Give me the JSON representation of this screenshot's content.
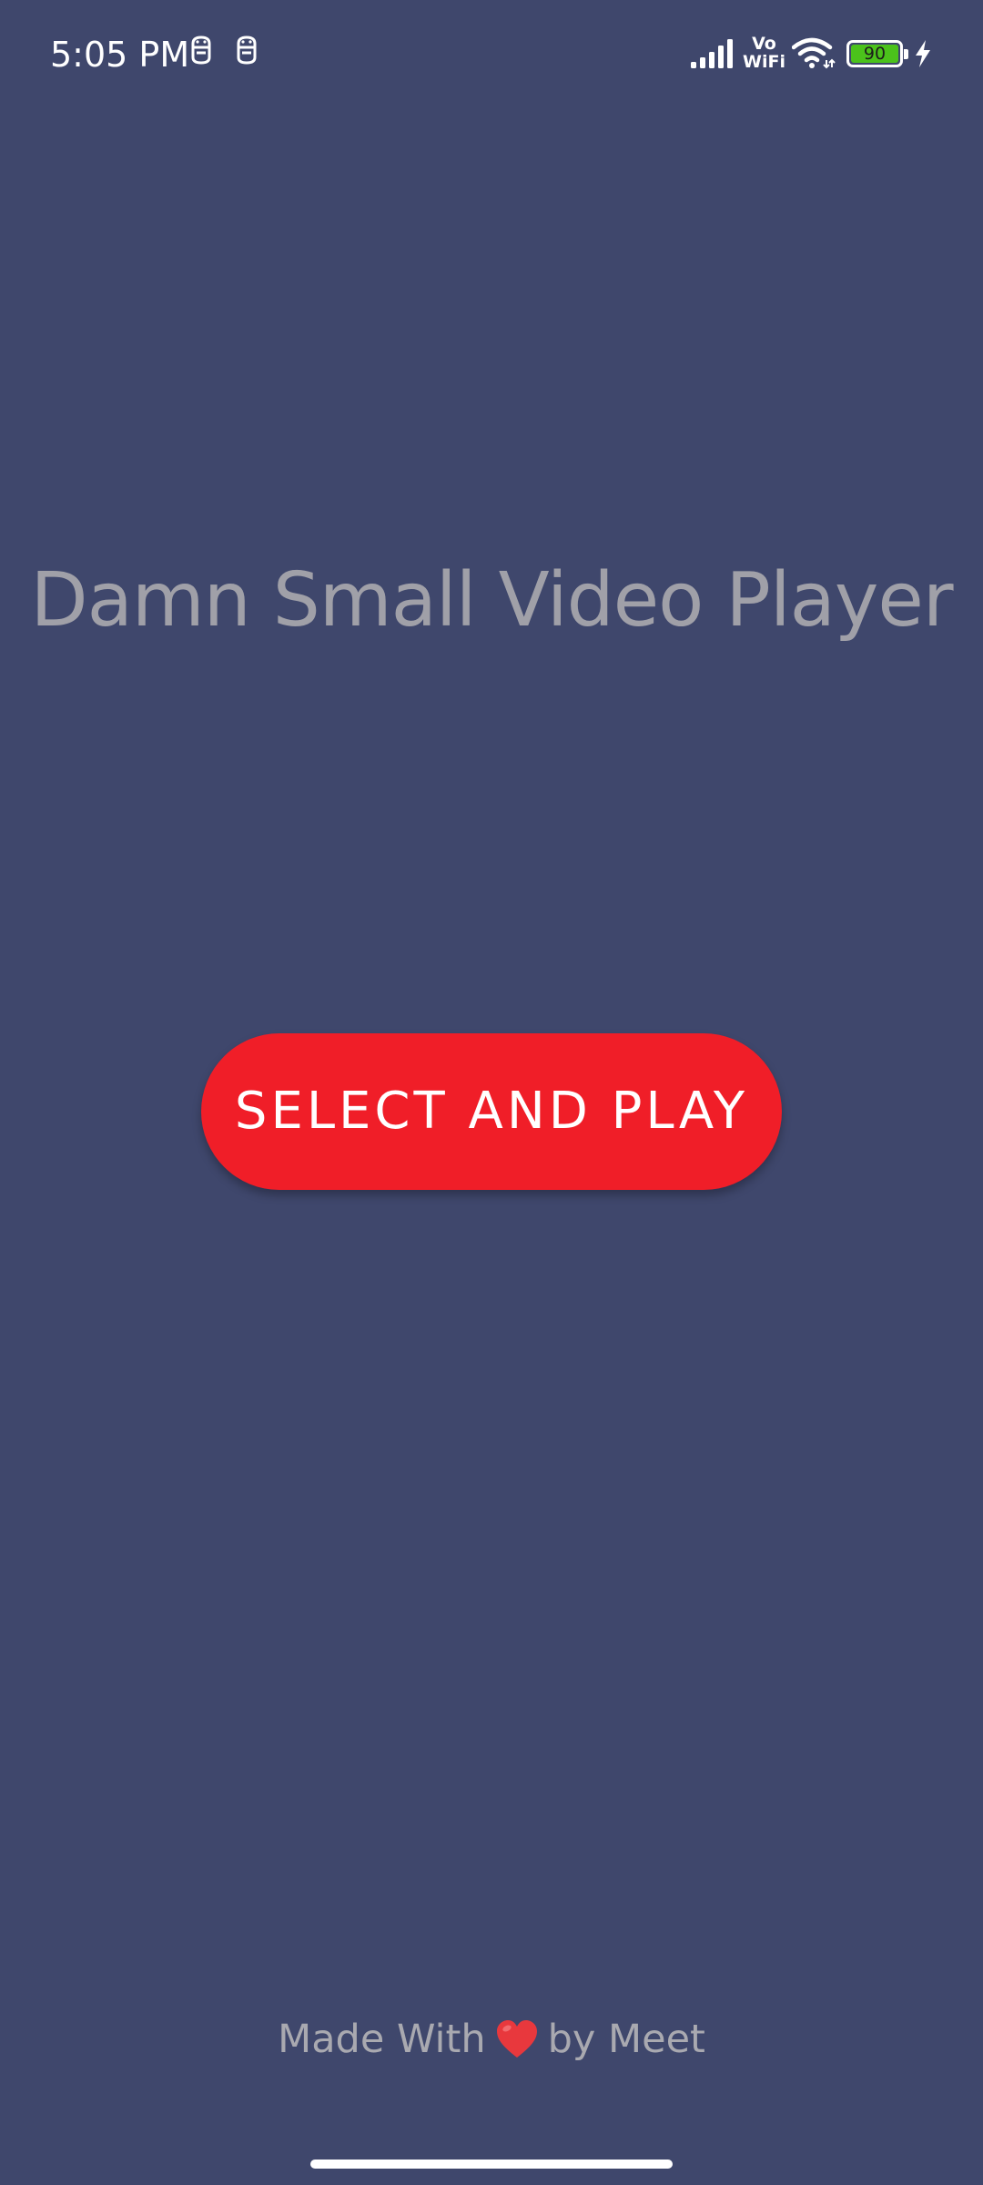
{
  "status_bar": {
    "time": "5:05 PM",
    "vowifi_top": "Vo",
    "vowifi_bottom": "WiFi",
    "battery_level": "90",
    "icons": [
      "notification-icon",
      "notification-icon",
      "signal-icon",
      "vowifi-icon",
      "wifi-icon",
      "battery-icon",
      "charging-bolt-icon"
    ],
    "battery_color": "#4bc21b"
  },
  "main": {
    "title": "Damn Small Video Player",
    "button_label": "SELECT AND PLAY",
    "button_color": "#f01e28",
    "background_color": "#3f476c"
  },
  "footer": {
    "prefix": "Made With",
    "suffix": "by Meet",
    "icon": "heart-icon"
  }
}
